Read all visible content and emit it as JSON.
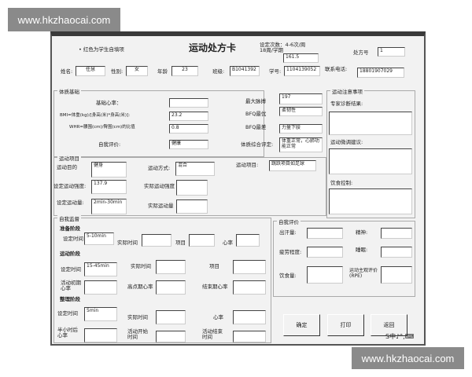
{
  "watermark": "www.hkzhaocai.com",
  "header": {
    "note": "• 红色为学生自填项",
    "title": "运动处方卡",
    "freq_line1": "设定次数：4-6次/周",
    "freq_line2": "18周/学期",
    "freq_value": "161.5",
    "rx_label": "处方号",
    "rx_value": "1"
  },
  "student": {
    "name_label": "姓名:",
    "name": "任慧",
    "gender_label": "性别:",
    "gender": "女",
    "age_label": "年龄",
    "age": "23",
    "class_label": "班级:",
    "class": "B1041392",
    "id_label": "学号:",
    "id": "1104139052",
    "phone_label": "联系电话:",
    "phone": "18801907029"
  },
  "physique": {
    "title": "体质基础",
    "hr_label": "基础心率：",
    "hr": "",
    "bmi_label": "BMI=体重(kg)/[身高(米)*身高(米)]:",
    "bmi": "23.2",
    "whr_label": "WHR=腰围(cm)/臀围(cm)的比值",
    "whr": "0.8",
    "self_label": "自我评价:",
    "self": "健康",
    "maxp_label": "最大脉搏",
    "maxp": "197",
    "best_label": "BFQ最优",
    "best": "柔韧性",
    "worst_label": "BFQ最差",
    "worst": "力量下肢",
    "overall_label": "体质综合评定:",
    "overall": "体重正常，心肺功能正常"
  },
  "exercise": {
    "title": "运动项目",
    "goal_label": "运动目的",
    "goal": "健身",
    "mode_label": "运动方式:",
    "mode": "混合",
    "item_label": "运动项目:",
    "item": "跳跃项目如足球",
    "set_int_label": "设定运动强度:",
    "set_int": "137.9",
    "act_int_label": "实际运动强度",
    "act_int": "",
    "set_vol_label": "设定运动量:",
    "set_vol": "2min-30min",
    "act_vol_label": "实际运动量",
    "act_vol": ""
  },
  "notes": {
    "title": "运动注意事项",
    "diag_label": "专家诊断结果:",
    "adjust_label": "运动微调建议:",
    "diet_label": "饮食控制:"
  },
  "monitor": {
    "title": "自我监督",
    "prep": "准备阶段",
    "set_time": "设定时间",
    "actual_time": "实际时间",
    "item": "项目",
    "hr": "心率",
    "prep_time": "5-10min",
    "ex": "运动阶段",
    "ex_time": "15-45min",
    "early_hr": "活动初期心率",
    "peak_hr": "高点期心率",
    "end_hr": "结束期心率",
    "cool": "整理阶段",
    "cool_time": "5min",
    "half_hr": "半小时后心率",
    "start_time": "活动开始时间",
    "end_time": "活动结束时间"
  },
  "selfeval": {
    "title": "自我评价",
    "sweat": "出汗量:",
    "spirit": "精神:",
    "fatigue": "疲劳程度:",
    "sleep": "睡眠:",
    "appetite": "饮食量:",
    "rpe": "运动主观评价(RPE)"
  },
  "buttons": {
    "ok": "确定",
    "print": "打印",
    "back": "返回"
  },
  "tray": "S中♪°,⌨"
}
